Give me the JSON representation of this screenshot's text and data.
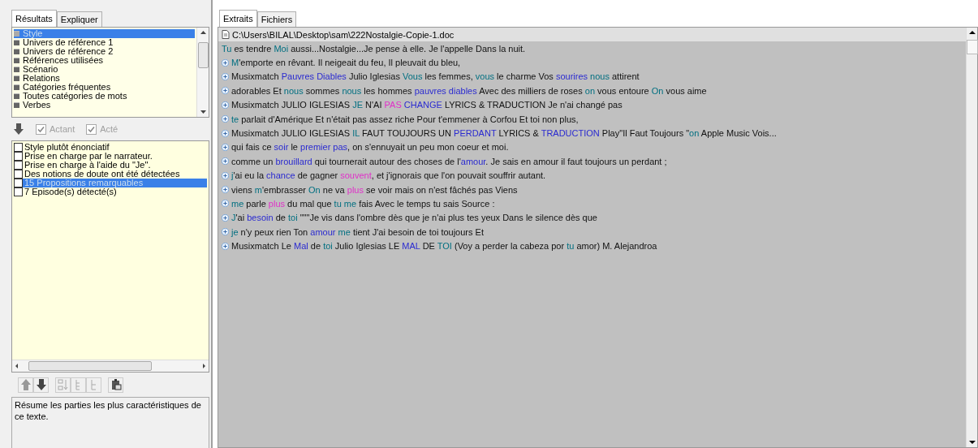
{
  "left_tabs": [
    {
      "label": "Résultats",
      "selected": true
    },
    {
      "label": "Expliquer",
      "selected": false
    }
  ],
  "categories": [
    {
      "label": "Style",
      "selected": true
    },
    {
      "label": "Univers de référence 1",
      "selected": false
    },
    {
      "label": "Univers de référence 2",
      "selected": false
    },
    {
      "label": "Références utilisées",
      "selected": false
    },
    {
      "label": "Scénario",
      "selected": false
    },
    {
      "label": "Relations",
      "selected": false
    },
    {
      "label": "Catégories fréquentes",
      "selected": false
    },
    {
      "label": "Toutes catégories de mots",
      "selected": false
    },
    {
      "label": "Verbes",
      "selected": false
    }
  ],
  "filters": [
    {
      "label": "Actant",
      "checked": true,
      "disabled": true
    },
    {
      "label": "Acté",
      "checked": true,
      "disabled": true
    }
  ],
  "results": [
    {
      "label": "Style plutôt énonciatif",
      "checked": false,
      "selected": false
    },
    {
      "label": "Prise en charge par le narrateur.",
      "checked": false,
      "selected": false
    },
    {
      "label": "Prise en charge à l'aide du \"Je\".",
      "checked": false,
      "selected": false
    },
    {
      "label": "Des notions de doute ont été détectées",
      "checked": false,
      "selected": false
    },
    {
      "label": "15 Propositions remarquables",
      "checked": false,
      "selected": true
    },
    {
      "label": "7 Episode(s) détecté(s)",
      "checked": false,
      "selected": false
    }
  ],
  "description": "Résume les parties les plus caractéristiques de ce texte.",
  "right_tabs": [
    {
      "label": "Extraits",
      "selected": true
    },
    {
      "label": "Fichiers",
      "selected": false
    }
  ],
  "file_path": "C:\\Users\\BILAL\\Desktop\\sam\\222Nostalgie-Copie-1.doc",
  "extracts": [
    {
      "expandable": false,
      "segments": [
        {
          "text": "Tu",
          "kind": "pronoun"
        },
        {
          "text": " es tendre ",
          "kind": "plain"
        },
        {
          "text": "Moi",
          "kind": "pronoun"
        },
        {
          "text": " aussi...Nostalgie...Je pense à elle. Je l'appelle Dans la nuit.",
          "kind": "plain"
        }
      ]
    },
    {
      "expandable": true,
      "segments": [
        {
          "text": "M",
          "kind": "pronoun"
        },
        {
          "text": "'emporte  en rêvant. Il neigeait du feu,  Il pleuvait du bleu,",
          "kind": "plain"
        }
      ]
    },
    {
      "expandable": true,
      "segments": [
        {
          "text": "Musixmatch ",
          "kind": "plain"
        },
        {
          "text": "Pauvres Diables",
          "kind": "noun"
        },
        {
          "text": " Julio Iglesias ",
          "kind": "plain"
        },
        {
          "text": "Vous",
          "kind": "pronoun"
        },
        {
          "text": " les femmes, ",
          "kind": "plain"
        },
        {
          "text": "vous",
          "kind": "pronoun"
        },
        {
          "text": " le charme Vos ",
          "kind": "plain"
        },
        {
          "text": "sourires ",
          "kind": "noun"
        },
        {
          "text": "nous",
          "kind": "pronoun"
        },
        {
          "text": " attirent",
          "kind": "plain"
        }
      ]
    },
    {
      "expandable": true,
      "segments": [
        {
          "text": "adorables Et ",
          "kind": "plain"
        },
        {
          "text": "nous",
          "kind": "pronoun"
        },
        {
          "text": " sommes ",
          "kind": "plain"
        },
        {
          "text": "nous",
          "kind": "pronoun"
        },
        {
          "text": " les hommes ",
          "kind": "plain"
        },
        {
          "text": "pauvres diables",
          "kind": "noun"
        },
        {
          "text": " Avec des milliers de roses ",
          "kind": "plain"
        },
        {
          "text": "on",
          "kind": "pronoun"
        },
        {
          "text": " vous entoure ",
          "kind": "plain"
        },
        {
          "text": "On",
          "kind": "pronoun"
        },
        {
          "text": " vous aime",
          "kind": "plain"
        }
      ]
    },
    {
      "expandable": true,
      "segments": [
        {
          "text": "Musixmatch JULIO IGLESIAS ",
          "kind": "plain"
        },
        {
          "text": "JE",
          "kind": "pronoun"
        },
        {
          "text": " N'AI ",
          "kind": "plain"
        },
        {
          "text": "PAS ",
          "kind": "adverb"
        },
        {
          "text": "CHANGE",
          "kind": "noun"
        },
        {
          "text": " LYRICS & TRADUCTION  Je n'ai changé pas",
          "kind": "plain"
        }
      ]
    },
    {
      "expandable": true,
      "segments": [
        {
          "text": "te",
          "kind": "pronoun"
        },
        {
          "text": " parlait d'Amérique  Et n'était pas assez riche Pour  t'emmener à Corfou Et toi non plus,",
          "kind": "plain"
        }
      ]
    },
    {
      "expandable": true,
      "segments": [
        {
          "text": "Musixmatch JULIO IGLESIAS ",
          "kind": "plain"
        },
        {
          "text": "IL",
          "kind": "pronoun"
        },
        {
          "text": " FAUT TOUJOURS UN ",
          "kind": "plain"
        },
        {
          "text": "PERDANT",
          "kind": "noun"
        },
        {
          "text": " LYRICS & ",
          "kind": "plain"
        },
        {
          "text": "TRADUCTION",
          "kind": "noun"
        },
        {
          "text": " Play\"Il Faut Toujours \"",
          "kind": "plain"
        },
        {
          "text": "on",
          "kind": "pronoun"
        },
        {
          "text": " Apple Music Vois...",
          "kind": "plain"
        }
      ]
    },
    {
      "expandable": true,
      "segments": [
        {
          "text": "qui fais ce ",
          "kind": "plain"
        },
        {
          "text": "soir",
          "kind": "noun"
        },
        {
          "text": " le ",
          "kind": "plain"
        },
        {
          "text": "premier pas",
          "kind": "noun"
        },
        {
          "text": ",  on s'ennuyait un peu mon coeur et moi.",
          "kind": "plain"
        }
      ]
    },
    {
      "expandable": true,
      "segments": [
        {
          "text": "comme un ",
          "kind": "plain"
        },
        {
          "text": "brouillard",
          "kind": "noun"
        },
        {
          "text": " qui tournerait autour des choses de l'",
          "kind": "plain"
        },
        {
          "text": "amour",
          "kind": "noun"
        },
        {
          "text": ". Je sais en amour il faut toujours un perdant ;",
          "kind": "plain"
        }
      ]
    },
    {
      "expandable": true,
      "segments": [
        {
          "text": "j",
          "kind": "pronoun"
        },
        {
          "text": "'ai eu la ",
          "kind": "plain"
        },
        {
          "text": "chance",
          "kind": "noun"
        },
        {
          "text": " de gagner ",
          "kind": "plain"
        },
        {
          "text": "souvent",
          "kind": "adverb"
        },
        {
          "text": ",  et j'ignorais que l'on pouvait souffrir autant.",
          "kind": "plain"
        }
      ]
    },
    {
      "expandable": true,
      "segments": [
        {
          "text": "viens ",
          "kind": "plain"
        },
        {
          "text": "m",
          "kind": "pronoun"
        },
        {
          "text": "'embrasser ",
          "kind": "plain"
        },
        {
          "text": "On",
          "kind": "pronoun"
        },
        {
          "text": " ne va ",
          "kind": "plain"
        },
        {
          "text": "plus",
          "kind": "adverb"
        },
        {
          "text": " se voir  mais on n'est fâchés pas Viens",
          "kind": "plain"
        }
      ]
    },
    {
      "expandable": true,
      "segments": [
        {
          "text": "me",
          "kind": "pronoun"
        },
        {
          "text": " parle ",
          "kind": "plain"
        },
        {
          "text": "plus",
          "kind": "adverb"
        },
        {
          "text": " du mal que ",
          "kind": "plain"
        },
        {
          "text": "tu me",
          "kind": "pronoun"
        },
        {
          "text": " fais Avec le temps  tu sais Source :",
          "kind": "plain"
        }
      ]
    },
    {
      "expandable": true,
      "segments": [
        {
          "text": "J",
          "kind": "pronoun"
        },
        {
          "text": "'ai ",
          "kind": "plain"
        },
        {
          "text": "besoin",
          "kind": "noun"
        },
        {
          "text": " de ",
          "kind": "plain"
        },
        {
          "text": "toi",
          "kind": "pronoun"
        },
        {
          "text": " \"\"\"Je vis dans l'ombre  dès que je n'ai plus tes yeux Dans le silence dès que",
          "kind": "plain"
        }
      ]
    },
    {
      "expandable": true,
      "segments": [
        {
          "text": "je",
          "kind": "pronoun"
        },
        {
          "text": " n'y peux rien Ton ",
          "kind": "plain"
        },
        {
          "text": "amour ",
          "kind": "noun"
        },
        {
          "text": "me",
          "kind": "pronoun"
        },
        {
          "text": " tient  J'ai besoin de toi toujours Et",
          "kind": "plain"
        }
      ]
    },
    {
      "expandable": true,
      "segments": [
        {
          "text": "Musixmatch Le ",
          "kind": "plain"
        },
        {
          "text": "Mal",
          "kind": "noun"
        },
        {
          "text": " de ",
          "kind": "plain"
        },
        {
          "text": "toi",
          "kind": "pronoun"
        },
        {
          "text": " Julio Iglesias LE ",
          "kind": "plain"
        },
        {
          "text": "MAL",
          "kind": "noun"
        },
        {
          "text": " DE ",
          "kind": "plain"
        },
        {
          "text": "TOI",
          "kind": "pronoun"
        },
        {
          "text": " (Voy a perder la cabeza por ",
          "kind": "plain"
        },
        {
          "text": "tu",
          "kind": "pronoun"
        },
        {
          "text": " amor) M. Alejandroa",
          "kind": "plain"
        }
      ]
    }
  ]
}
